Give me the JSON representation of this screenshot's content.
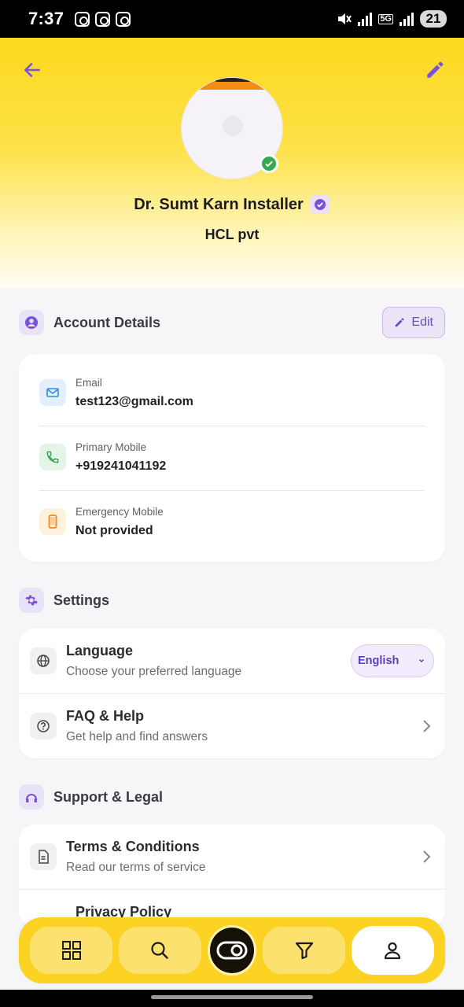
{
  "status_bar": {
    "time": "7:37",
    "network": "5G",
    "battery": "21"
  },
  "profile": {
    "name": "Dr. Sumt Karn Installer",
    "company": "HCL pvt"
  },
  "account_section": {
    "title": "Account Details",
    "edit_label": "Edit",
    "items": [
      {
        "label": "Email",
        "value": "test123@gmail.com",
        "icon": "mail-icon"
      },
      {
        "label": "Primary Mobile",
        "value": "+919241041192",
        "icon": "phone-icon"
      },
      {
        "label": "Emergency Mobile",
        "value": "Not provided",
        "icon": "mobile-device-icon"
      }
    ]
  },
  "settings_section": {
    "title": "Settings",
    "language": {
      "title": "Language",
      "subtitle": "Choose your preferred language",
      "selected": "English"
    },
    "faq": {
      "title": "FAQ & Help",
      "subtitle": "Get help and find answers"
    }
  },
  "support_section": {
    "title": "Support & Legal",
    "terms": {
      "title": "Terms & Conditions",
      "subtitle": "Read our terms of service"
    },
    "privacy": {
      "title": "Privacy Policy"
    }
  },
  "bottom_nav": {
    "items": [
      "grid-icon",
      "search-icon",
      "toggle-icon",
      "filter-icon",
      "user-icon"
    ],
    "active": "user-icon"
  },
  "colors": {
    "accent": "#fcd81c",
    "primary": "#6a4fc0",
    "success": "#34a853"
  }
}
